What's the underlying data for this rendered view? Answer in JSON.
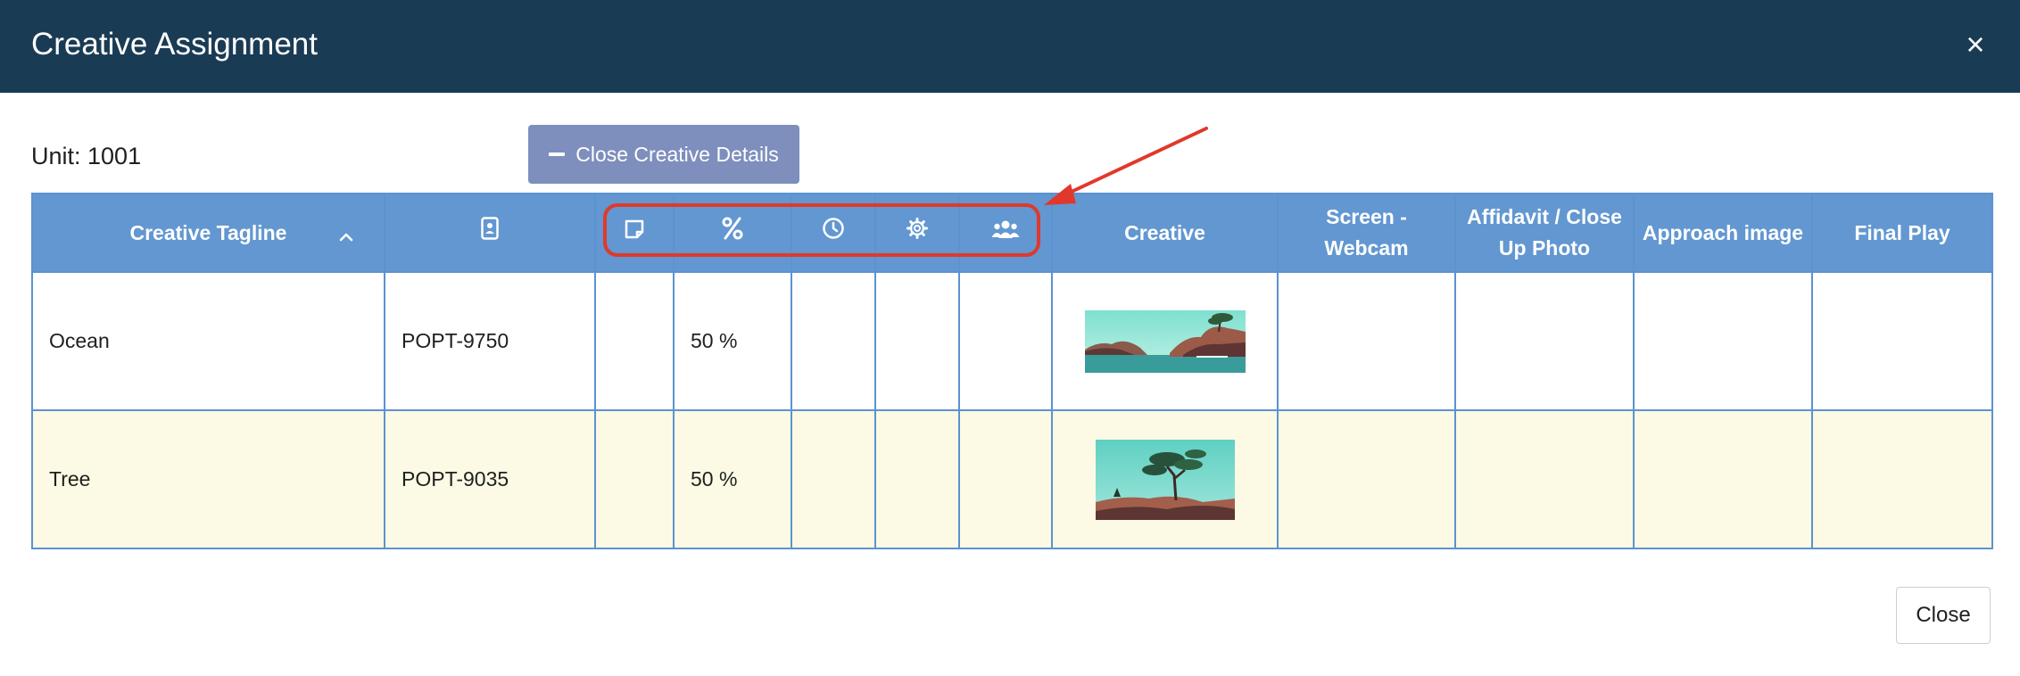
{
  "modal": {
    "title": "Creative Assignment",
    "close_icon": "×"
  },
  "unit_label": "Unit: 1001",
  "details_button": {
    "label": "Close Creative Details",
    "icon": "minus-icon"
  },
  "table": {
    "headers": {
      "tagline": "Creative Tagline",
      "sort_icon": "chevron-up-icon",
      "id_icon": "contact-card-icon",
      "note_icon": "sticky-note-icon",
      "percent_icon": "percent-icon",
      "clock_icon": "clock-icon",
      "settings_icon": "gear-icon",
      "users_icon": "users-icon",
      "creative": "Creative",
      "screen": "Screen - Webcam",
      "affidavit": "Affidavit / Close Up Photo",
      "approach": "Approach image",
      "final_play": "Final Play"
    },
    "rows": [
      {
        "tagline": "Ocean",
        "code": "POPT-9750",
        "percent": "50 %",
        "thumbnail": "ocean-coast-image"
      },
      {
        "tagline": "Tree",
        "code": "POPT-9035",
        "percent": "50 %",
        "thumbnail": "tree-cliff-image"
      }
    ]
  },
  "annotation": {
    "color": "#e0392b"
  },
  "colors": {
    "header_bg": "#1a3b54",
    "table_header_bg": "#6297d1",
    "button_bg": "#7e8fbd",
    "alt_row_bg": "#fcfae4"
  },
  "footer": {
    "close_label": "Close"
  }
}
